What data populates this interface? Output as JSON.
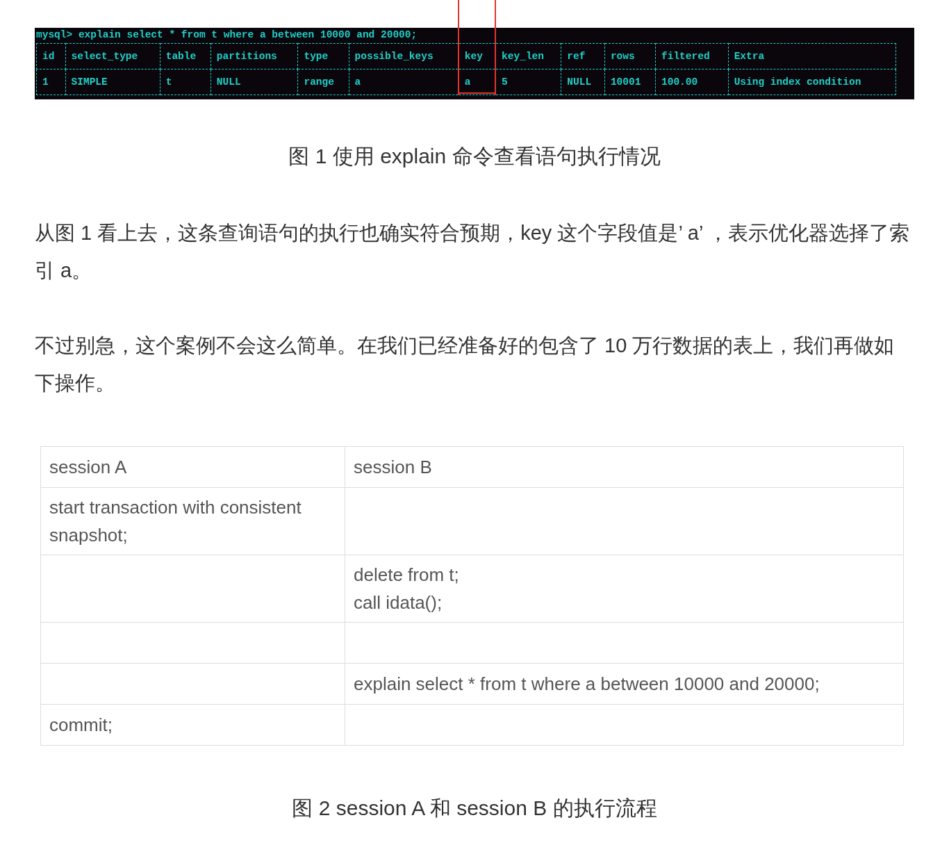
{
  "terminal": {
    "prompt_line": "mysql> explain select * from t where a between 10000 and 20000;",
    "columns": [
      {
        "label": "id",
        "highlighted": false
      },
      {
        "label": "select_type",
        "highlighted": false
      },
      {
        "label": "table",
        "highlighted": false
      },
      {
        "label": "partitions",
        "highlighted": false
      },
      {
        "label": "type",
        "highlighted": false
      },
      {
        "label": "possible_keys",
        "highlighted": false
      },
      {
        "label": "key",
        "highlighted": true
      },
      {
        "label": "key_len",
        "highlighted": false
      },
      {
        "label": "ref",
        "highlighted": false
      },
      {
        "label": "rows",
        "highlighted": false
      },
      {
        "label": "filtered",
        "highlighted": false
      },
      {
        "label": "Extra",
        "highlighted": false
      }
    ],
    "rows": [
      [
        "1",
        "SIMPLE",
        "t",
        "NULL",
        "range",
        "a",
        "a",
        "5",
        "NULL",
        "10001",
        "100.00",
        "Using index condition"
      ]
    ]
  },
  "caption_1": "图 1 使用 explain 命令查看语句执行情况",
  "paragraphs": [
    "从图 1 看上去，这条查询语句的执行也确实符合预期，key 这个字段值是’ a’ ，表示优化器选择了索引 a。",
    "不过别急，这个案例不会这么简单。在我们已经准备好的包含了 10 万行数据的表上，我们再做如下操作。"
  ],
  "session_table": {
    "columns": [
      "session A",
      "session B"
    ],
    "rows": [
      {
        "session_a": [
          "start transaction with consistent snapshot;"
        ]
      },
      {
        "session_b": [
          "delete from t;",
          "call idata();"
        ]
      },
      {},
      {
        "session_b": [
          "explain select * from t where a between 10000 and 20000;"
        ]
      },
      {
        "session_a": [
          "commit;"
        ]
      }
    ]
  },
  "caption_2": "图 2 session A 和 session B 的执行流程"
}
